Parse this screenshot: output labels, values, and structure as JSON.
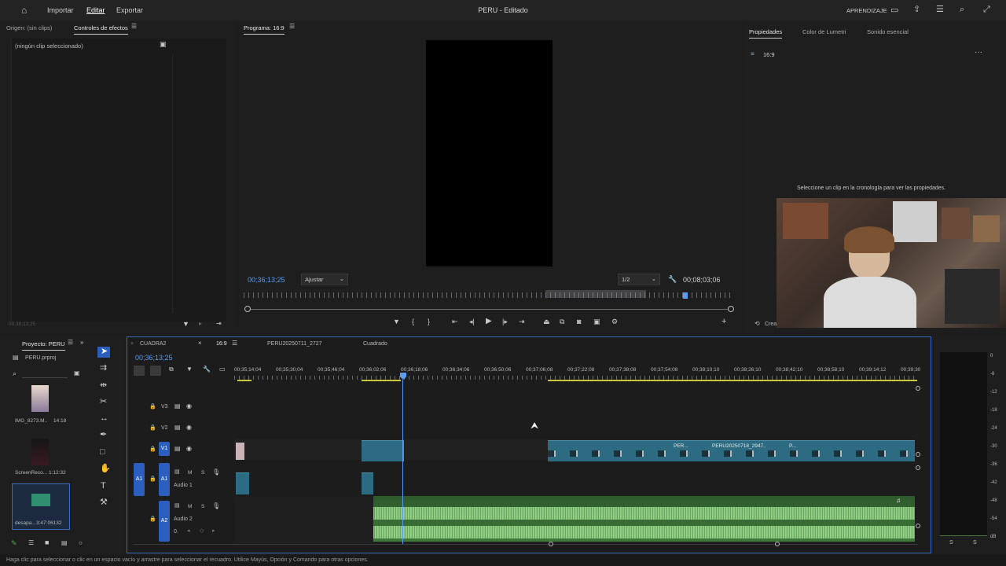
{
  "topbar": {
    "menu": [
      "Importar",
      "Editar",
      "Exportar"
    ],
    "active_menu": "Editar",
    "title": "PERU - Editado",
    "right_label": "APRENDIZAJE"
  },
  "effects_panel": {
    "tabs": [
      "Origen: (sin clips)",
      "Controles de efectos"
    ],
    "active_tab": "Controles de efectos",
    "no_clip": "(ningún clip seleccionado)",
    "footer_timecode": "00;36;13;25"
  },
  "program_monitor": {
    "title": "Programa: 16:9",
    "timecode_current": "00;36;13;25",
    "fit_label": "Ajustar",
    "resolution": "1/2",
    "timecode_duration": "00;08;03;06"
  },
  "properties_panel": {
    "tabs": [
      "Propiedades",
      "Color de Lumetri",
      "Sonido esencial"
    ],
    "active_tab": "Propiedades",
    "sequence_name": "16:9",
    "hint": "Seleccione un clip en la cronología para ver las propiedades.",
    "bottom_label": "Crea"
  },
  "project_panel": {
    "title": "Proyecto: PERU",
    "file": "PERU.prproj",
    "items": [
      {
        "name": "IMG_8273.M..",
        "duration": "14:18"
      },
      {
        "name": "ScreenReco...",
        "duration": "1:12:32"
      },
      {
        "name": "desapa...",
        "duration": "3:47:06132"
      }
    ]
  },
  "timeline": {
    "tabs": [
      "CUADRA2",
      "16:9",
      "PERU20250711_2727",
      "Cuadrado"
    ],
    "active_tab": "16:9",
    "playhead_timecode": "00;36;13;25",
    "ruler_labels": [
      "00;35;14;04",
      "00;35;30;04",
      "00;35;46;04",
      "00;36;02;06",
      "00;36;18;06",
      "00;36;34;06",
      "00;36;50;06",
      "00;37;06;08",
      "00;37;22;08",
      "00;37;38;08",
      "00;37;54;08",
      "00;38;10;10",
      "00;38;26;10",
      "00;38;42;10",
      "00;38;58;10",
      "00;39;14;12",
      "00;39;30"
    ],
    "tracks": {
      "v3": "V3",
      "v2": "V2",
      "v1": "V1",
      "a1": "A1",
      "a1_name": "Audio 1",
      "a2": "A2",
      "a2_name": "Audio 2",
      "mix": "0."
    },
    "clip_labels": [
      "PER...",
      "PERU20250718_2947..",
      "P..."
    ]
  },
  "meters": {
    "scale": [
      "0",
      "-6",
      "-12",
      "-18",
      "-24",
      "-30",
      "-36",
      "-42",
      "-48",
      "-54",
      "dB"
    ],
    "channels": [
      "S",
      "S"
    ]
  },
  "status_bar": {
    "text": "Haga clic para seleccionar o clic en un espacio vacío y arrastre para seleccionar el recuadro. Utilice Mayús, Opción y Comando para otras opciones."
  },
  "colors": {
    "accent_blue": "#3a6bbd",
    "timecode_blue": "#5b9bf0",
    "video_clip": "#2c6b82",
    "audio_clip": "#3e7a3a"
  }
}
